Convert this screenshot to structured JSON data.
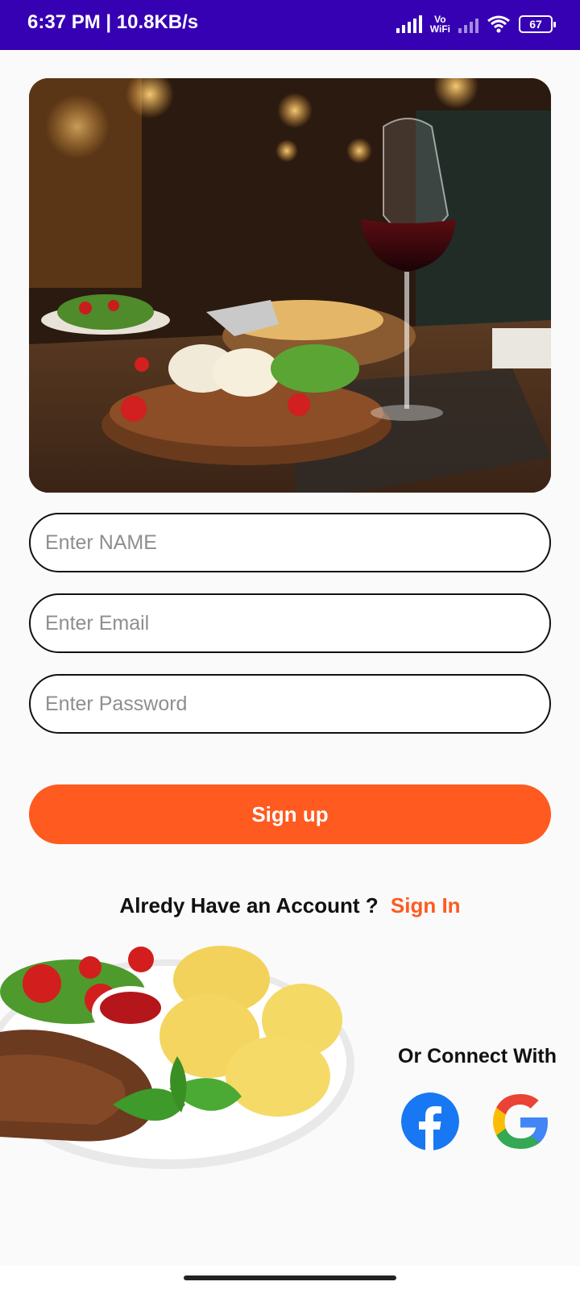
{
  "status_bar": {
    "time": "6:37 PM | 10.8KB/s",
    "vowifi_top": "Vo",
    "vowifi_bottom": "WiFi",
    "battery": "67",
    "color": "#3600b3"
  },
  "form": {
    "name_placeholder": "Enter NAME",
    "email_placeholder": "Enter Email",
    "password_placeholder": "Enter Password",
    "signup_label": "Sign up"
  },
  "account": {
    "prompt": "Alredy Have an Account ?",
    "signin_label": "Sign In"
  },
  "social": {
    "label": "Or Connect With",
    "facebook_icon": "facebook-icon",
    "google_icon": "google-icon"
  },
  "colors": {
    "accent": "#ff5a1f",
    "facebook": "#1877f2",
    "background": "#fafafa"
  }
}
